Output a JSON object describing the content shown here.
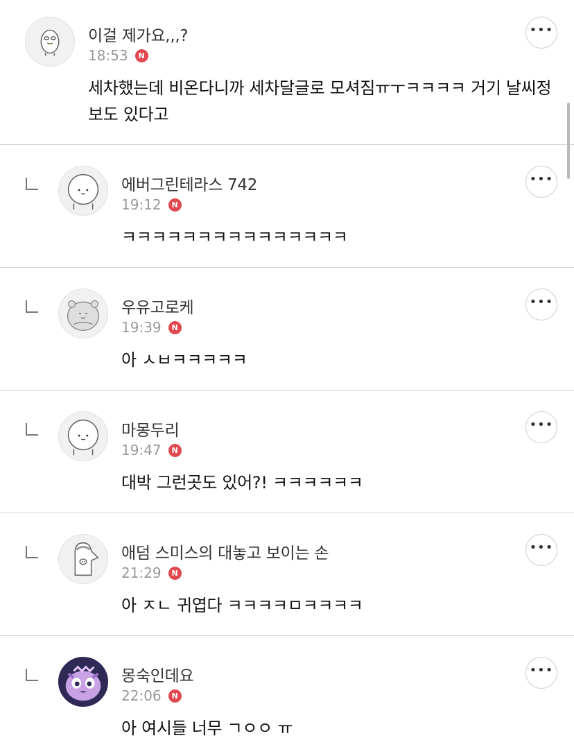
{
  "comments": [
    {
      "author": "이걸 제가요,,,?",
      "time": "18:53",
      "badge": "N",
      "text": "세차했는데 비온다니까 세차달글로 모셔짐ㅠㅜㅋㅋㅋㅋ 거기 날씨정보도 있다고",
      "more": "•••",
      "avatar_icon": "duck-character-icon"
    },
    {
      "author": "에버그린테라스 742",
      "time": "19:12",
      "badge": "N",
      "text": "ㅋㅋㅋㅋㅋㅋㅋㅋㅋㅋㅋㅋㅋㅋㅋ",
      "more": "•••",
      "avatar_icon": "bear-character-icon"
    },
    {
      "author": "우유고로케",
      "time": "19:39",
      "badge": "N",
      "text": "아 ㅅㅂㅋㅋㅋㅋㅋ",
      "more": "•••",
      "avatar_icon": "hamster-character-icon"
    },
    {
      "author": "마몽두리",
      "time": "19:47",
      "badge": "N",
      "text": "대박 그런곳도 있어?! ㅋㅋㅋㅋㅋㅋ",
      "more": "•••",
      "avatar_icon": "bear-character-icon"
    },
    {
      "author": "애덤 스미스의 대놓고 보이는 손",
      "time": "21:29",
      "badge": "N",
      "text": "아 ㅈㄴ 귀엽다 ㅋㅋㅋㅋㅁㅋㅋㅋㅋ",
      "more": "•••",
      "avatar_icon": "penguin-character-icon"
    },
    {
      "author": "몽숙인데요",
      "time": "22:06",
      "badge": "N",
      "text": "아 여시들 너무 ㄱㅇㅇ ㅠ",
      "more": "•••",
      "avatar_icon": "purple-monster-icon"
    }
  ]
}
